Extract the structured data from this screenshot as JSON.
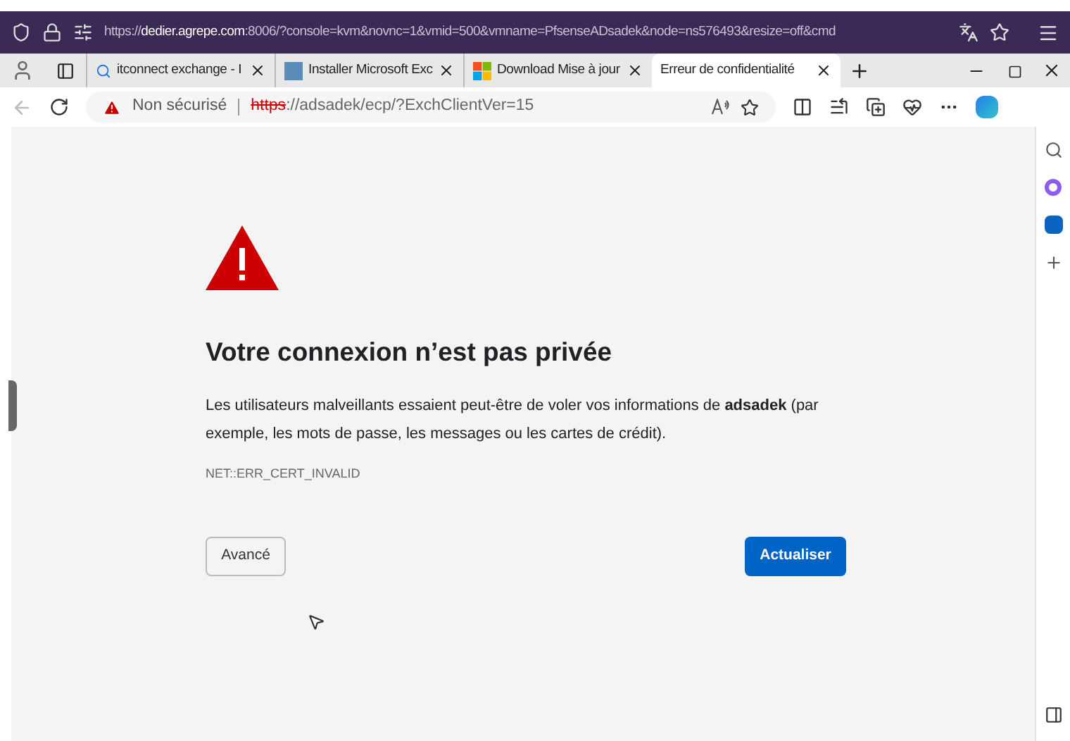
{
  "outer_browser": {
    "url": {
      "scheme": "https://",
      "host": "dedier.agrepe.com",
      "rest": ":8006/?console=kvm&novnc=1&vmid=500&vmname=PfsenseADsadek&node=ns576493&resize=off&cmd"
    }
  },
  "tabs": [
    {
      "label": "itconnect exchange - I",
      "kind": "search",
      "selected": false
    },
    {
      "label": "Installer Microsoft Exc",
      "kind": "it",
      "selected": false
    },
    {
      "label": "Download Mise à jour",
      "kind": "windows",
      "selected": false
    },
    {
      "label": "Erreur de confidentialité",
      "kind": "error",
      "selected": true
    }
  ],
  "address_bar": {
    "security": "Non sécurisé",
    "scheme": "https",
    "rest": "://adsadek/ecp/?ExchClientVer=15"
  },
  "error_page": {
    "title": "Votre connexion n’est pas privée",
    "message": "Les utilisateurs malveillants essaient peut-être de voler vos informations de **adsadek** (par exemple, les mots de passe, les messages ou les cartes de crédit).",
    "code": "NET::ERR_CERT_INVALID",
    "buttons": [
      {
        "label": "Avancé",
        "kind": "secondary"
      },
      {
        "label": "Actualiser",
        "kind": "primary"
      }
    ]
  }
}
